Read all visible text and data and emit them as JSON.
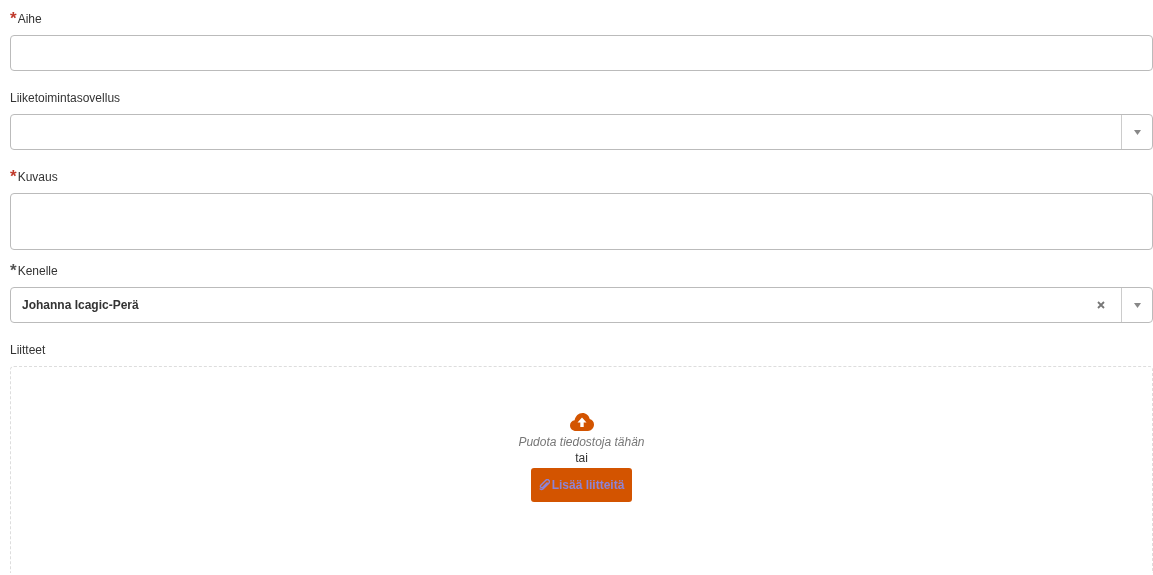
{
  "fields": [
    {
      "kind": "text",
      "label": "Aihe",
      "required_mark": "*",
      "color": "#c0392b"
    },
    {
      "kind": "select",
      "label": "Liiketoimintasovellus"
    },
    {
      "kind": "textarea",
      "label": "Kuvaus",
      "required_mark": "*",
      "color": "#c0392b"
    },
    {
      "kind": "select",
      "label": "Kenelle",
      "required_mark": "*",
      "color": "#555555",
      "value": "Johanna Icagic-Perä",
      "clearable": true
    }
  ],
  "attachments": {
    "label": "Liitteet",
    "drop_text": "Pudota tiedostoja tähän",
    "or_text": "tai",
    "button": "Lisää liitteitä"
  }
}
